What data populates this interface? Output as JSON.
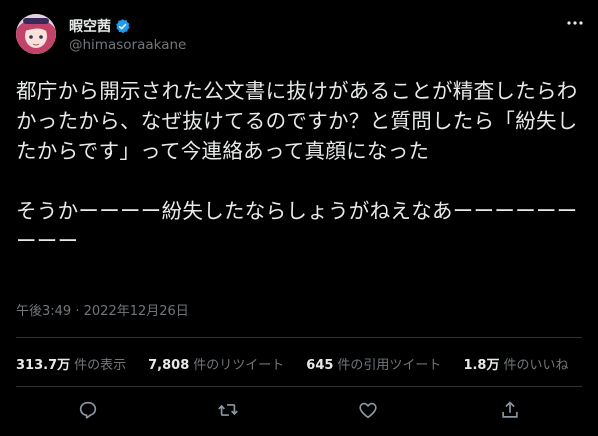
{
  "author": {
    "display_name": "暇空茜",
    "handle": "@himasoraakane",
    "verified": true
  },
  "tweet": {
    "text": "都庁から開示された公文書に抜けがあることが精査したらわかったから、なぜ抜けてるのですか？と質問したら「紛失したからです」って今連絡あって真顔になった\n\nそうかーーーー紛失したならしょうがねえなあーーーーーーーーー",
    "time": "午後3:49",
    "separator": "·",
    "date": "2022年12月26日"
  },
  "stats": [
    {
      "value": "313.7万",
      "label": "件の表示"
    },
    {
      "value": "7,808",
      "label": "件のリツイート"
    },
    {
      "value": "645",
      "label": "件の引用ツイート"
    },
    {
      "value": "1.8万",
      "label": "件のいいね"
    }
  ],
  "icons": {
    "more": "more-icon",
    "reply": "reply-icon",
    "retweet": "retweet-icon",
    "like": "like-icon",
    "share": "share-icon",
    "verified": "verified-badge-icon"
  },
  "colors": {
    "background": "#000000",
    "text": "#e7e9ea",
    "secondary": "#71767b",
    "divider": "#2f3336",
    "verified": "#1d9bf0"
  }
}
